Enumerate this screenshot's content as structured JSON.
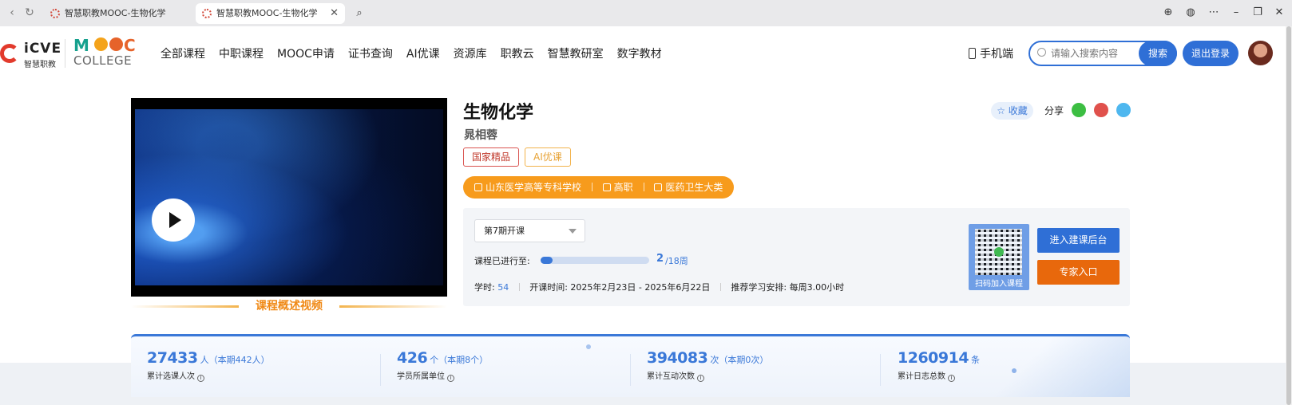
{
  "browser": {
    "tabs": [
      {
        "title": "智慧职教MOOC-生物化学"
      },
      {
        "title": "智慧职教MOOC-生物化学",
        "close": "✕"
      }
    ]
  },
  "header": {
    "logo_icve": "iCVE",
    "logo_icve_cn": "智慧职教",
    "logo_mooc": "MOOC",
    "logo_college": "COLLEGE",
    "nav": [
      "全部课程",
      "中职课程",
      "MOOC申请",
      "证书查询",
      "AI优课",
      "资源库",
      "职教云",
      "智慧教研室",
      "数字教材"
    ],
    "mobile_label": "手机端",
    "search_placeholder": "请输入搜索内容",
    "search_button": "搜索",
    "logout_button": "退出登录"
  },
  "course": {
    "title": "生物化学",
    "teacher": "晁相蓉",
    "tags": [
      "国家精品",
      "AI优课"
    ],
    "school": "山东医学高等专科学校",
    "level": "高职",
    "category": "医药卫生大类",
    "favorite_label": "☆ 收藏",
    "share_label": "分享",
    "overview_video_label": "课程概述视频"
  },
  "info": {
    "term": "第7期开课",
    "progress_label": "课程已进行至:",
    "progress_current": "2",
    "progress_total": "/18周",
    "progress_fraction": 0.111,
    "hours_label": "学时:",
    "hours_value": "54",
    "start_time": "开课时间: 2025年2月23日 - 2025年6月22日",
    "schedule": "推荐学习安排: 每周3.00小时",
    "qr_caption": "扫码加入课程",
    "backend_button": "进入建课后台",
    "expert_button": "专家入口"
  },
  "stats": [
    {
      "value": "27433",
      "unit": "人（本期442人）",
      "label": "累计选课人次"
    },
    {
      "value": "426",
      "unit": "个（本期8个）",
      "label": "学员所属单位"
    },
    {
      "value": "394083",
      "unit": "次（本期0次）",
      "label": "累计互动次数"
    },
    {
      "value": "1260914",
      "unit": "条",
      "label": "累计日志总数"
    }
  ]
}
